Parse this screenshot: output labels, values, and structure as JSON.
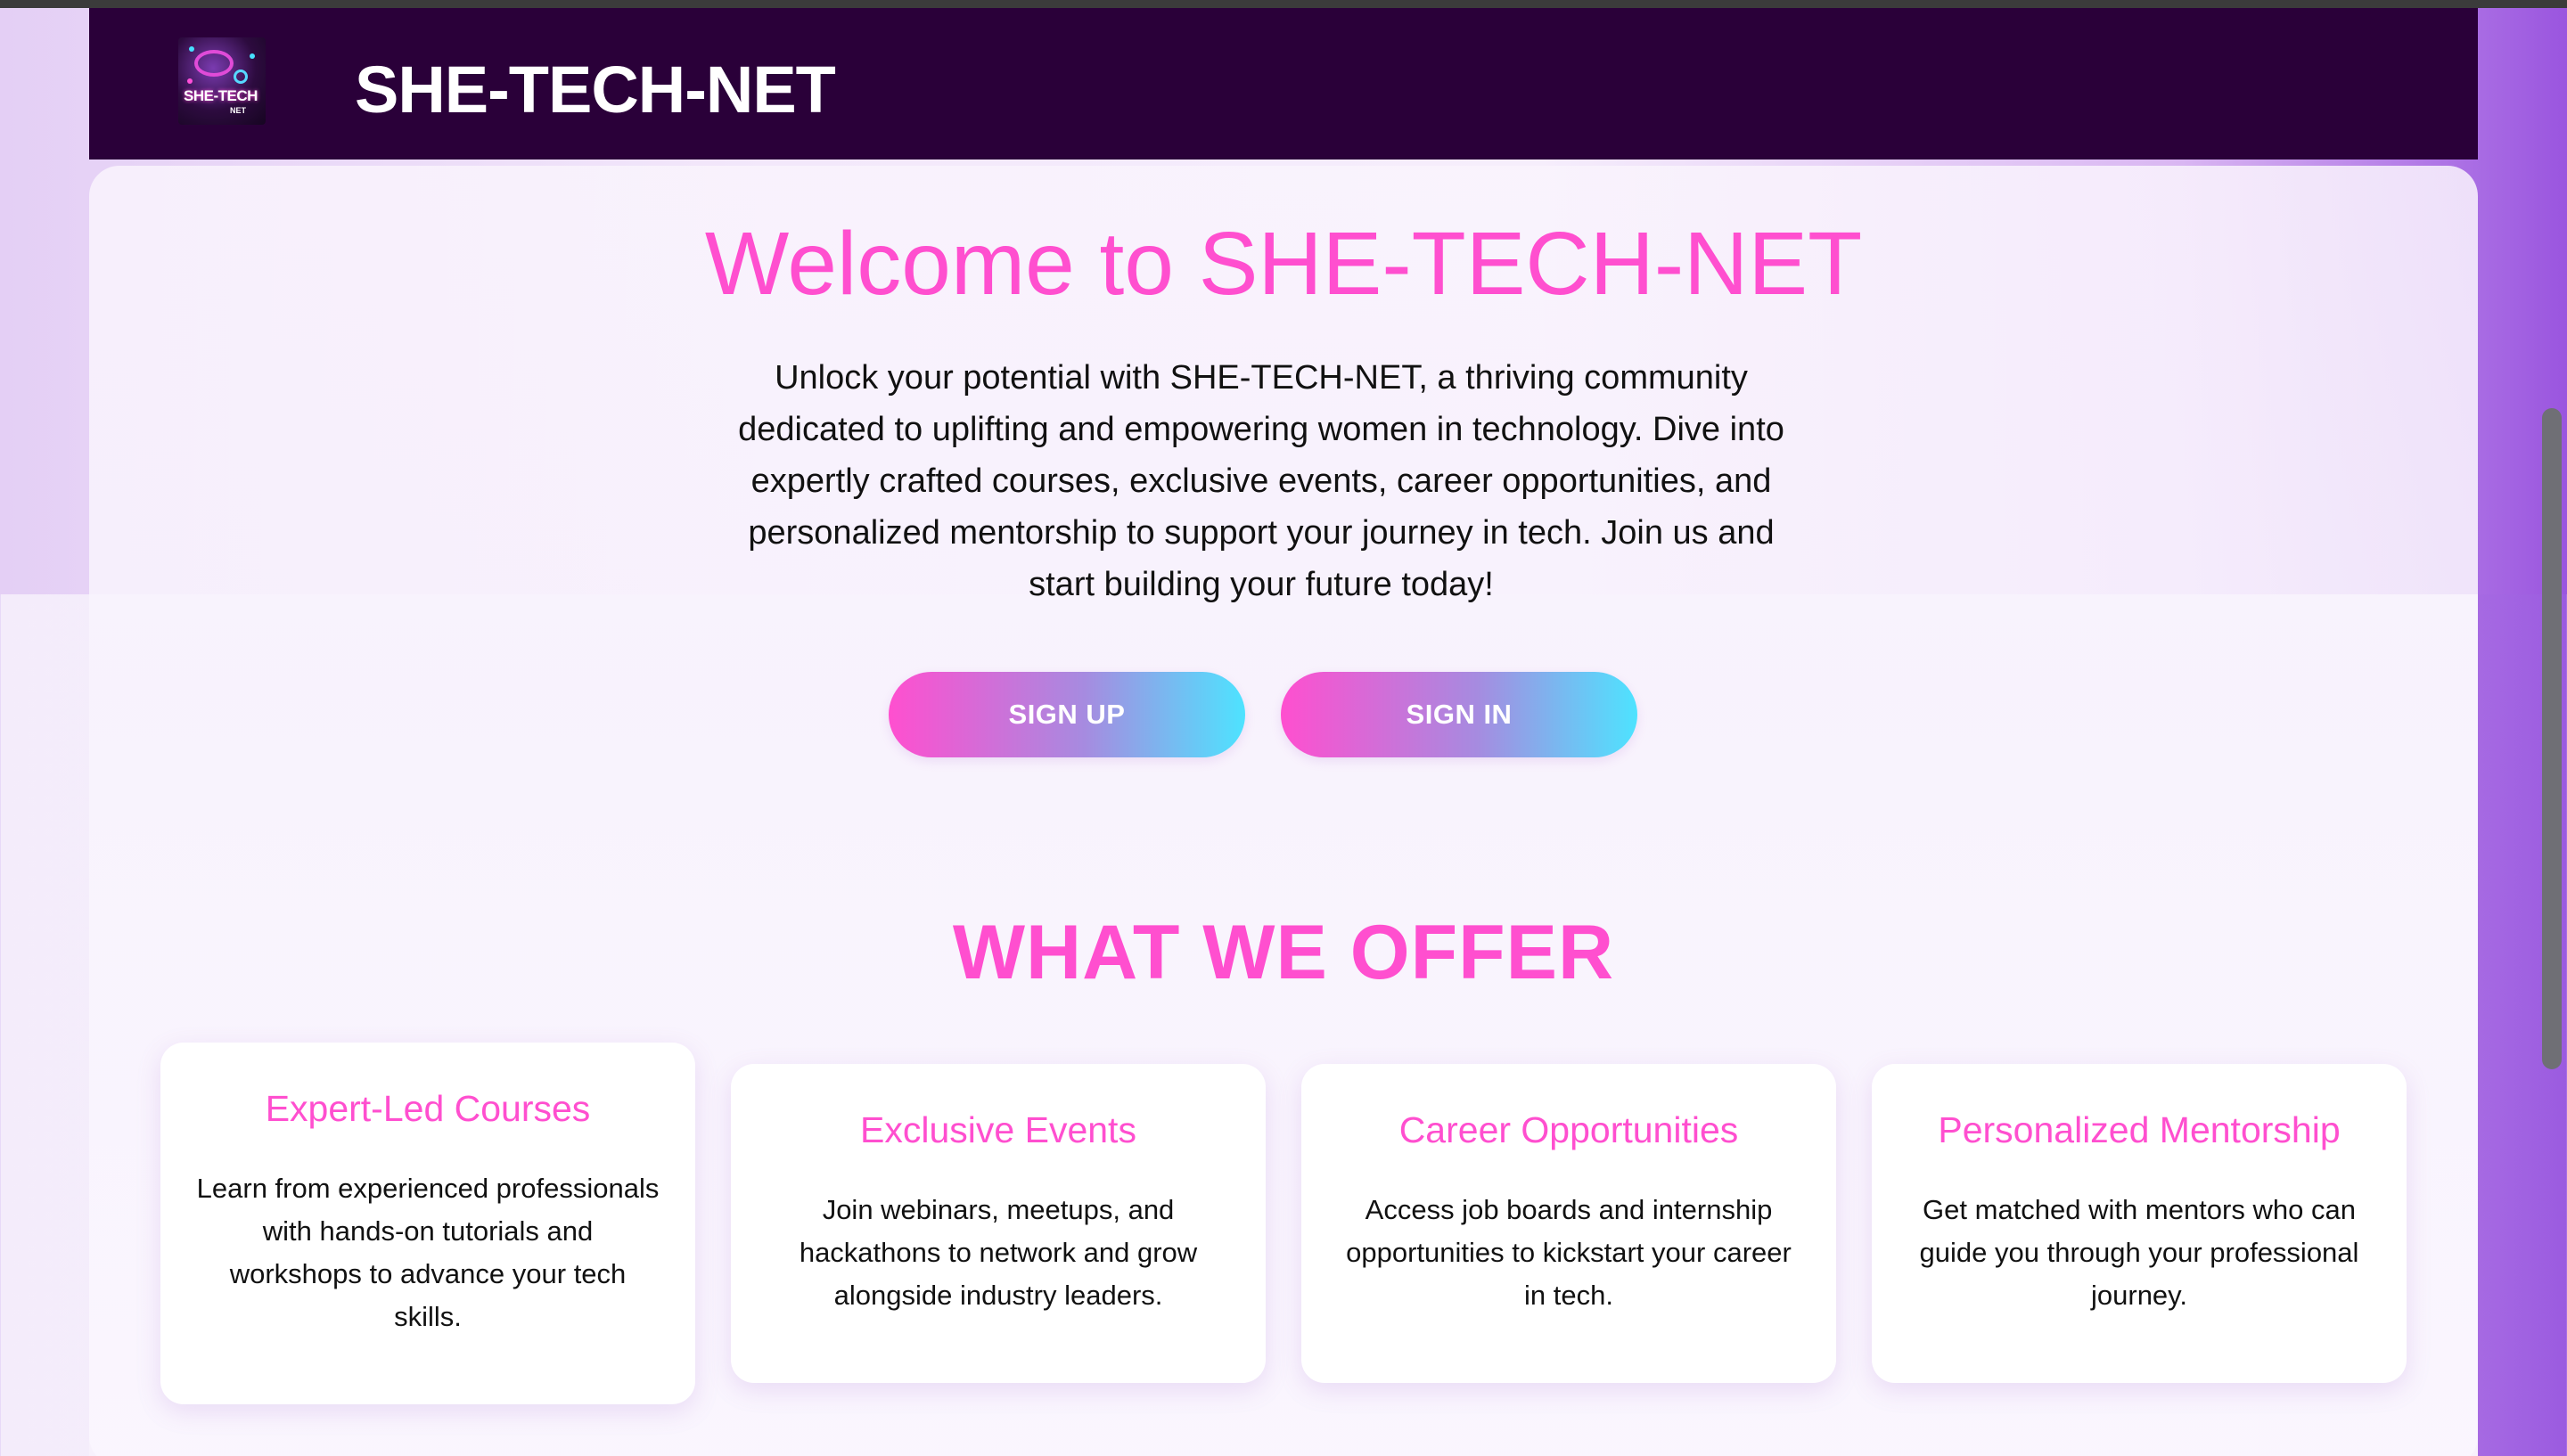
{
  "header": {
    "logo_text": "SHE-TECH",
    "logo_subtext": "NET",
    "brand": "SHE-TECH-NET"
  },
  "hero": {
    "title": "Welcome to SHE-TECH-NET",
    "text": "Unlock your potential with SHE-TECH-NET, a thriving community dedicated to uplifting and empowering women in technology. Dive into expertly crafted courses, exclusive events, career opportunities, and personalized mentorship to support your journey in tech. Join us and start building your future today!",
    "signup_label": "SIGN UP",
    "signin_label": "SIGN IN"
  },
  "offer": {
    "title": "WHAT WE OFFER",
    "cards": [
      {
        "title": "Expert-Led Courses",
        "text": "Learn from experienced professionals with hands-on tutorials and workshops to advance your tech skills."
      },
      {
        "title": "Exclusive Events",
        "text": "Join webinars, meetups, and hackathons to network and grow alongside industry leaders."
      },
      {
        "title": "Career Opportunities",
        "text": "Access job boards and internship opportunities to kickstart your career in tech."
      },
      {
        "title": "Personalized Mentorship",
        "text": "Get matched with mentors who can guide you through your professional journey."
      }
    ]
  },
  "colors": {
    "navbar": "#2a0039",
    "accent_pink": "#ff4fcf",
    "accent_cyan": "#4ee3ff"
  }
}
